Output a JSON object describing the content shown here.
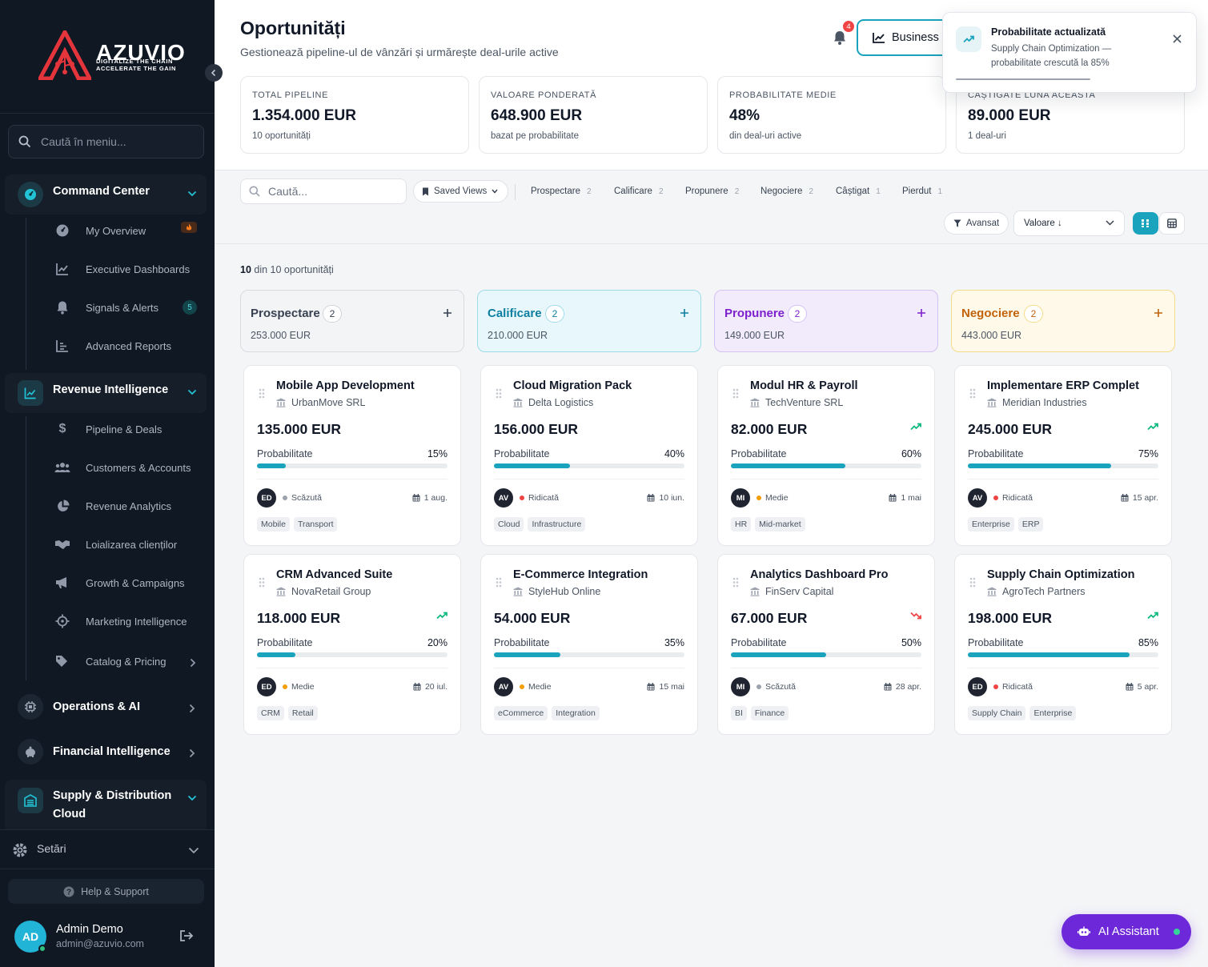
{
  "brand": {
    "name": "AZUVIO",
    "tagline_1": "DIGITALIZE THE CHAIN",
    "tagline_2": "ACCELERATE THE GAIN"
  },
  "sidebar": {
    "search_placeholder": "Caută în meniu...",
    "groups": [
      {
        "label": "Command Center",
        "icon": "dashboard-icon",
        "expanded": true
      },
      {
        "label": "Revenue Intelligence",
        "icon": "chart-line-icon",
        "expanded": true
      },
      {
        "label": "Operations & AI",
        "icon": "chip-icon",
        "expanded": false
      },
      {
        "label": "Financial Intelligence",
        "icon": "piggy-bank-icon",
        "expanded": false
      },
      {
        "label": "Supply & Distribution",
        "label2": "Cloud",
        "icon": "warehouse-icon",
        "expanded": true
      }
    ],
    "command_items": [
      {
        "label": "My Overview",
        "icon": "gauge-icon",
        "badge": "fire"
      },
      {
        "label": "Executive Dashboards",
        "icon": "chart-line-icon"
      },
      {
        "label": "Signals & Alerts",
        "icon": "bell-icon",
        "badge": "5"
      },
      {
        "label": "Advanced Reports",
        "icon": "report-icon"
      }
    ],
    "revenue_items": [
      {
        "label": "Pipeline & Deals",
        "icon": "dollar-icon"
      },
      {
        "label": "Customers & Accounts",
        "icon": "users-icon"
      },
      {
        "label": "Revenue Analytics",
        "icon": "pie-icon"
      },
      {
        "label": "Loializarea clienților",
        "icon": "handshake-icon"
      },
      {
        "label": "Growth & Campaigns",
        "icon": "megaphone-icon"
      },
      {
        "label": "Marketing Intelligence",
        "icon": "target-icon"
      },
      {
        "label": "Catalog & Pricing",
        "icon": "tag-icon"
      }
    ],
    "settings_label": "Setări",
    "help_label": "Help & Support",
    "user": {
      "initials": "AD",
      "name": "Admin Demo",
      "email": "admin@azuvio.com"
    }
  },
  "header": {
    "title": "Oportunități",
    "subtitle": "Gestionează pipeline-ul de vânzări și urmărește deal-urile active",
    "notifications": "4",
    "business_label": "Business"
  },
  "kpis": [
    {
      "label": "TOTAL PIPELINE",
      "value": "1.354.000 EUR",
      "sub": "10 oportunități"
    },
    {
      "label": "VALOARE PONDERATĂ",
      "value": "648.900 EUR",
      "sub": "bazat pe probabilitate"
    },
    {
      "label": "PROBABILITATE MEDIE",
      "value": "48%",
      "sub": "din deal-uri active"
    },
    {
      "label": "CÂȘTIGATE LUNA ACEASTA",
      "value": "89.000 EUR",
      "sub": "1 deal-uri"
    }
  ],
  "toolbar": {
    "search_placeholder": "Caută...",
    "saved_views": "Saved Views",
    "filters": [
      {
        "label": "Prospectare",
        "count": "2"
      },
      {
        "label": "Calificare",
        "count": "2"
      },
      {
        "label": "Propunere",
        "count": "2"
      },
      {
        "label": "Negociere",
        "count": "2"
      },
      {
        "label": "Câștigat",
        "count": "1"
      },
      {
        "label": "Pierdut",
        "count": "1"
      }
    ],
    "advanced": "Avansat",
    "sort": "Valoare ↓"
  },
  "count": {
    "shown": "10",
    "rest": "din 10 oportunități"
  },
  "columns": [
    {
      "name": "Prospectare",
      "count": "2",
      "value": "253.000 EUR",
      "color": "#374151"
    },
    {
      "name": "Calificare",
      "count": "2",
      "value": "210.000 EUR",
      "color": "#0e7fa0"
    },
    {
      "name": "Propunere",
      "count": "2",
      "value": "149.000 EUR",
      "color": "#7e22ce"
    },
    {
      "name": "Negociere",
      "count": "2",
      "value": "443.000 EUR",
      "color": "#c2620a"
    }
  ],
  "cards": [
    {
      "title": "Mobile App Development",
      "company": "UrbanMove SRL",
      "value": "135.000 EUR",
      "trend": "none",
      "prob_label": "Probabilitate",
      "prob": 15,
      "prob_text": "15%",
      "initials": "ED",
      "priority": "Scăzută",
      "priority_color": "#9ca3af",
      "date": "1 aug.",
      "tags": [
        "Mobile",
        "Transport"
      ]
    },
    {
      "title": "Cloud Migration Pack",
      "company": "Delta Logistics",
      "value": "156.000 EUR",
      "trend": "none",
      "prob_label": "Probabilitate",
      "prob": 40,
      "prob_text": "40%",
      "initials": "AV",
      "priority": "Ridicată",
      "priority_color": "#ef4444",
      "date": "10 iun.",
      "tags": [
        "Cloud",
        "Infrastructure"
      ]
    },
    {
      "title": "Modul HR & Payroll",
      "company": "TechVenture SRL",
      "value": "82.000 EUR",
      "trend": "up",
      "prob_label": "Probabilitate",
      "prob": 60,
      "prob_text": "60%",
      "initials": "MI",
      "priority": "Medie",
      "priority_color": "#f59e0b",
      "date": "1 mai",
      "tags": [
        "HR",
        "Mid-market"
      ]
    },
    {
      "title": "Implementare ERP Complet",
      "company": "Meridian Industries",
      "value": "245.000 EUR",
      "trend": "up",
      "prob_label": "Probabilitate",
      "prob": 75,
      "prob_text": "75%",
      "initials": "AV",
      "priority": "Ridicată",
      "priority_color": "#ef4444",
      "date": "15 apr.",
      "tags": [
        "Enterprise",
        "ERP"
      ]
    },
    {
      "title": "CRM Advanced Suite",
      "company": "NovaRetail Group",
      "value": "118.000 EUR",
      "trend": "up",
      "prob_label": "Probabilitate",
      "prob": 20,
      "prob_text": "20%",
      "initials": "ED",
      "priority": "Medie",
      "priority_color": "#f59e0b",
      "date": "20 iul.",
      "tags": [
        "CRM",
        "Retail"
      ]
    },
    {
      "title": "E-Commerce Integration",
      "company": "StyleHub Online",
      "value": "54.000 EUR",
      "trend": "none",
      "prob_label": "Probabilitate",
      "prob": 35,
      "prob_text": "35%",
      "initials": "AV",
      "priority": "Medie",
      "priority_color": "#f59e0b",
      "date": "15 mai",
      "tags": [
        "eCommerce",
        "Integration"
      ]
    },
    {
      "title": "Analytics Dashboard Pro",
      "company": "FinServ Capital",
      "value": "67.000 EUR",
      "trend": "down",
      "prob_label": "Probabilitate",
      "prob": 50,
      "prob_text": "50%",
      "initials": "MI",
      "priority": "Scăzută",
      "priority_color": "#9ca3af",
      "date": "28 apr.",
      "tags": [
        "BI",
        "Finance"
      ]
    },
    {
      "title": "Supply Chain Optimization",
      "company": "AgroTech Partners",
      "value": "198.000 EUR",
      "trend": "up",
      "prob_label": "Probabilitate",
      "prob": 85,
      "prob_text": "85%",
      "initials": "ED",
      "priority": "Ridicată",
      "priority_color": "#ef4444",
      "date": "5 apr.",
      "tags": [
        "Supply Chain",
        "Enterprise"
      ]
    }
  ],
  "toast": {
    "title": "Probabilitate actualizată",
    "message": "Supply Chain Optimization — probabilitate crescută la 85%"
  },
  "ai_assistant": "AI Assistant"
}
